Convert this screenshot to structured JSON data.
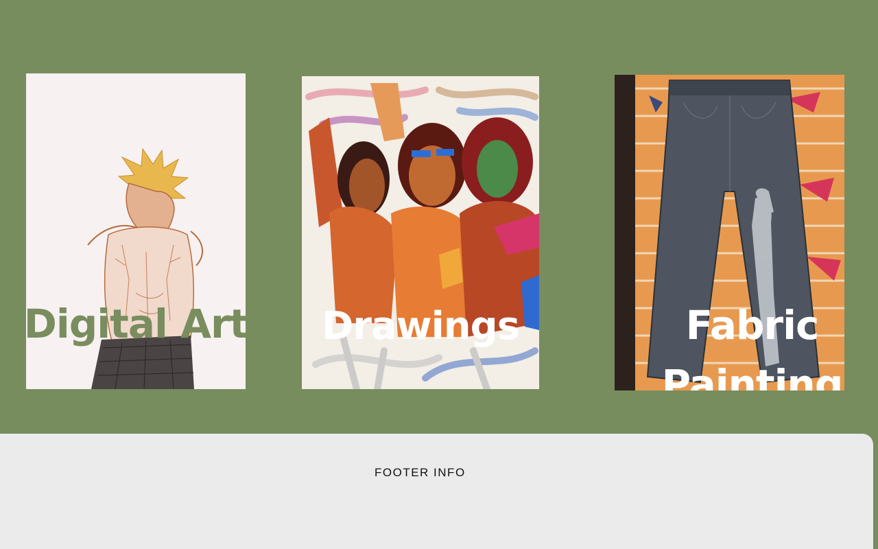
{
  "gallery": {
    "cards": [
      {
        "label": "Digital Art",
        "label_color": "#798d5e"
      },
      {
        "label": "Drawings",
        "label_color": "#ffffff"
      },
      {
        "label": "Fabric Painting",
        "label_color": "#ffffff"
      }
    ]
  },
  "footer": {
    "info": "FOOTER INFO"
  },
  "colors": {
    "background": "#788d5e",
    "footer_bg": "#ebebeb"
  }
}
